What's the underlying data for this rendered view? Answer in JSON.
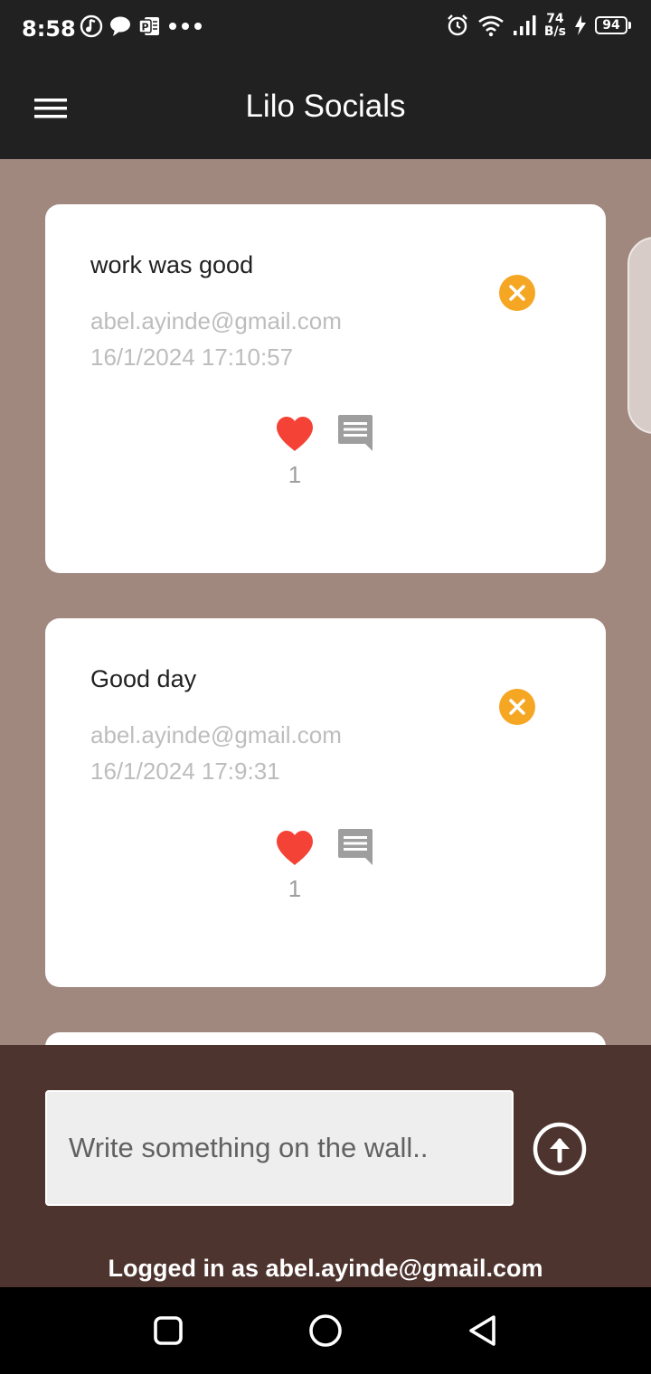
{
  "status_bar": {
    "time": "8:58",
    "net_speed_value": "74",
    "net_speed_unit": "B/s",
    "battery": "94",
    "left_icons": [
      "music-note-icon",
      "chat-bubble-icon",
      "publisher-icon",
      "more-dots-icon"
    ],
    "right_icons": [
      "alarm-icon",
      "wifi-icon",
      "signal-icon",
      "charging-icon"
    ]
  },
  "app_bar": {
    "title": "Lilo Socials",
    "menu_icon": "hamburger-menu-icon"
  },
  "posts": [
    {
      "message": "work was good",
      "user": "abel.ayinde@gmail.com",
      "timestamp": "16/1/2024 17:10:57",
      "likes": "1"
    },
    {
      "message": "Good day",
      "user": "abel.ayinde@gmail.com",
      "timestamp": "16/1/2024 17:9:31",
      "likes": "1"
    }
  ],
  "composer": {
    "placeholder": "Write something on the wall..",
    "value": ""
  },
  "footer": {
    "logged_in_text": "Logged in as abel.ayinde@gmail.com"
  },
  "colors": {
    "background": "#a1887f",
    "app_bar": "#212121",
    "bottom_panel": "#4e342e",
    "delete_accent": "#f5a623",
    "like_red": "#f44336",
    "muted_grey": "#9e9e9e"
  },
  "nav_bar": {
    "buttons": [
      "recents-square-icon",
      "home-circle-icon",
      "back-triangle-icon"
    ]
  }
}
